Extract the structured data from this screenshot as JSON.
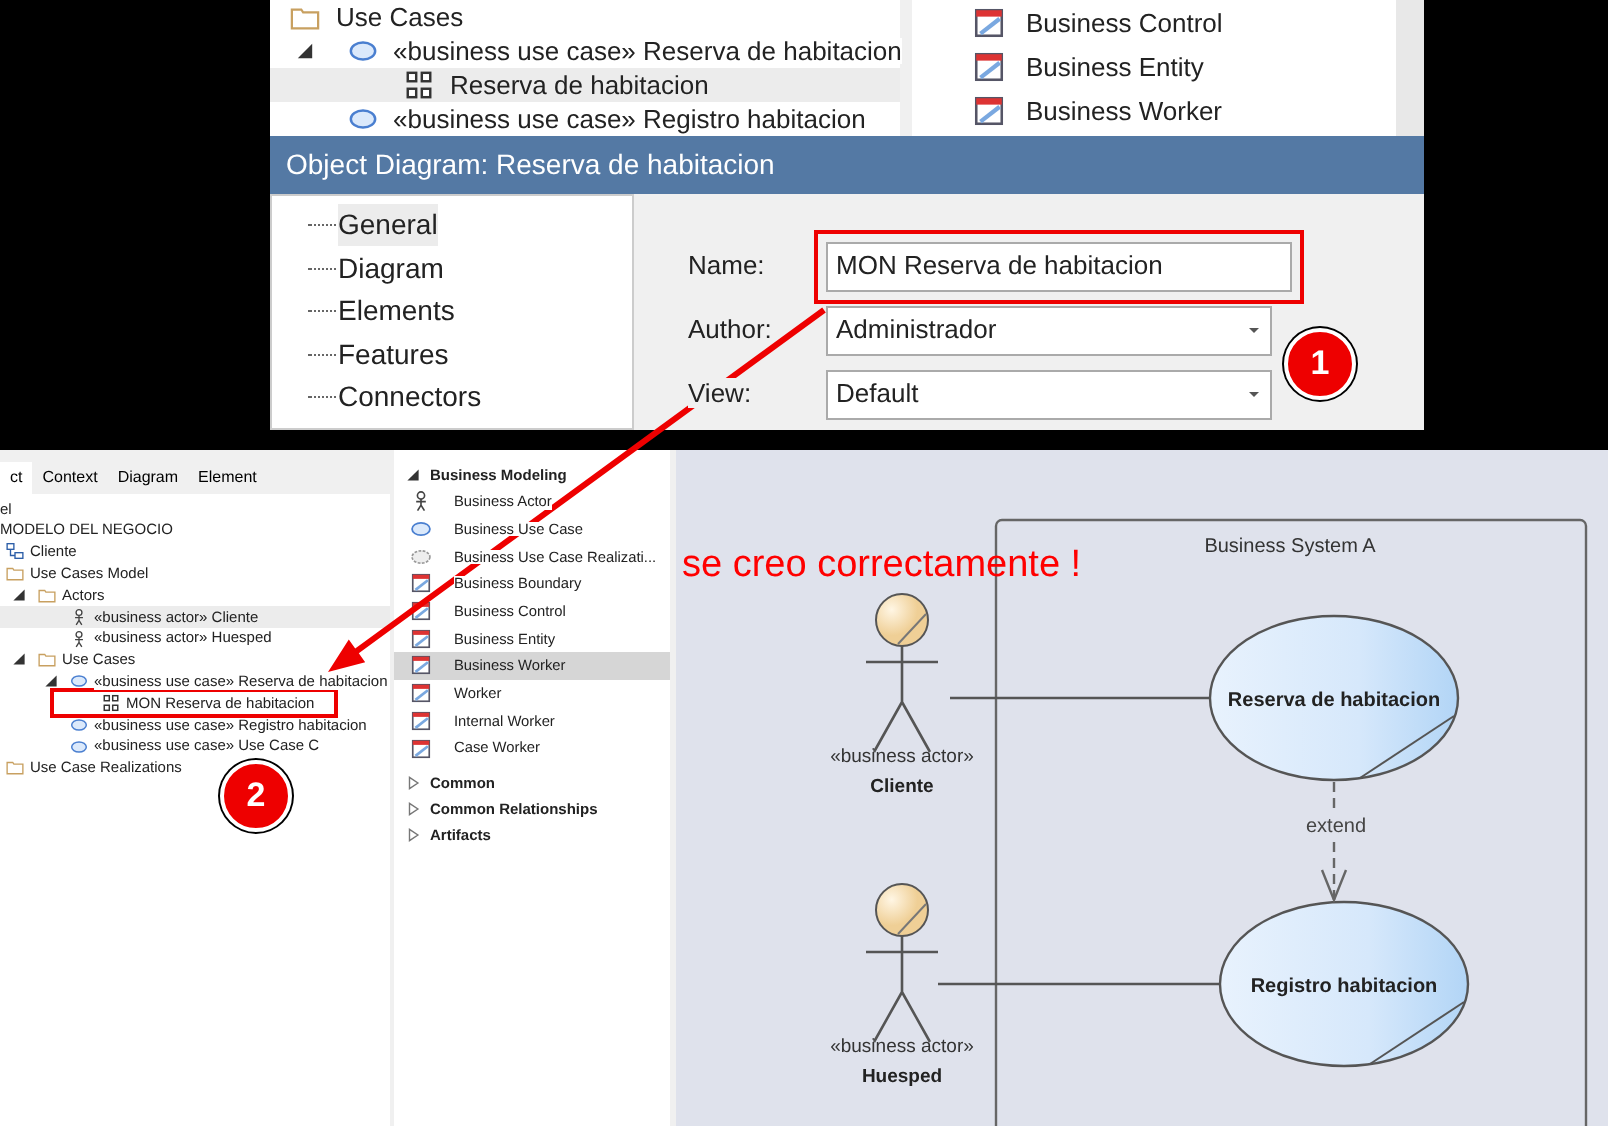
{
  "top_browser": {
    "items": [
      {
        "label": "Use Cases",
        "kind": "folder",
        "selected": false,
        "children": [
          {
            "label": "«business use case» Reserva de habitacion",
            "kind": "usecase",
            "expanded": true,
            "selected": false,
            "children": [
              {
                "label": "Reserva de habitacion",
                "kind": "diagram",
                "selected": true
              }
            ]
          },
          {
            "label": "«business use case» Registro habitacion",
            "kind": "usecase",
            "selected": false
          }
        ]
      }
    ]
  },
  "top_toolbox": {
    "items": [
      {
        "label": "Business Control",
        "kind": "class"
      },
      {
        "label": "Business Entity",
        "kind": "class"
      },
      {
        "label": "Business Worker",
        "kind": "class"
      }
    ]
  },
  "dialog": {
    "title": "Object Diagram: Reserva de habitacion",
    "nav": [
      {
        "label": "General",
        "selected": true
      },
      {
        "label": "Diagram",
        "selected": false
      },
      {
        "label": "Elements",
        "selected": false
      },
      {
        "label": "Features",
        "selected": false
      },
      {
        "label": "Connectors",
        "selected": false
      }
    ],
    "fields": [
      {
        "label": "Name:",
        "kind": "text",
        "value": "MON Reserva de habitacion",
        "highlighted": true
      },
      {
        "label": "Author:",
        "kind": "select",
        "value": "Administrador"
      },
      {
        "label": "View:",
        "kind": "select",
        "value": "Default"
      }
    ]
  },
  "browser": {
    "tabs": [
      {
        "label": "ct",
        "selected": true
      },
      {
        "label": "Context",
        "selected": false
      },
      {
        "label": "Diagram",
        "selected": false
      },
      {
        "label": "Element",
        "selected": false
      }
    ],
    "items": [
      {
        "label": "el",
        "selected": false
      },
      {
        "label": "MODELO DEL NEGOCIO",
        "selected": false,
        "children": [
          {
            "label": "Cliente",
            "kind": "package-diagram",
            "selected": false
          },
          {
            "label": "Use Cases Model",
            "kind": "folder",
            "selected": false,
            "children": [
              {
                "label": "Actors",
                "kind": "folder",
                "expanded": true,
                "selected": false,
                "children": [
                  {
                    "label": "«business actor» Cliente",
                    "kind": "actor",
                    "selected": true
                  },
                  {
                    "label": "«business actor» Huesped",
                    "kind": "actor",
                    "selected": false
                  }
                ]
              },
              {
                "label": "Use Cases",
                "kind": "folder",
                "expanded": true,
                "selected": false,
                "children": [
                  {
                    "label": "«business use case» Reserva de habitacion",
                    "kind": "usecase",
                    "expanded": true,
                    "selected": false,
                    "children": [
                      {
                        "label": "MON Reserva de habitacion",
                        "kind": "diagram",
                        "selected": false,
                        "highlighted": true
                      }
                    ]
                  },
                  {
                    "label": "«business use case» Registro habitacion",
                    "kind": "usecase",
                    "selected": false
                  },
                  {
                    "label": "«business use case» Use Case C",
                    "kind": "usecase",
                    "selected": false
                  }
                ]
              }
            ]
          },
          {
            "label": "Use Case Realizations",
            "kind": "folder",
            "selected": false
          }
        ]
      }
    ]
  },
  "toolbox": {
    "groups": [
      {
        "label": "Business Modeling",
        "expanded": true,
        "items": [
          {
            "label": "Business Actor",
            "kind": "actor",
            "selected": false
          },
          {
            "label": "Business Use Case",
            "kind": "usecase",
            "selected": false
          },
          {
            "label": "Business Use Case Realizati...",
            "kind": "realization",
            "selected": false
          },
          {
            "label": "Business Boundary",
            "kind": "class",
            "selected": false
          },
          {
            "label": "Business Control",
            "kind": "class",
            "selected": false
          },
          {
            "label": "Business Entity",
            "kind": "class",
            "selected": false
          },
          {
            "label": "Business Worker",
            "kind": "class",
            "selected": true
          },
          {
            "label": "Worker",
            "kind": "class",
            "selected": false
          },
          {
            "label": "Internal Worker",
            "kind": "class",
            "selected": false
          },
          {
            "label": "Case Worker",
            "kind": "class",
            "selected": false
          }
        ]
      },
      {
        "label": "Common",
        "expanded": false
      },
      {
        "label": "Common Relationships",
        "expanded": false
      },
      {
        "label": "Artifacts",
        "expanded": false
      }
    ]
  },
  "diagram": {
    "message": "se creo correctamente !",
    "boundary": "Business System A",
    "actors": [
      {
        "stereotype": "«business actor»",
        "name": "Cliente"
      },
      {
        "stereotype": "«business actor»",
        "name": "Huesped"
      }
    ],
    "use_cases": [
      {
        "name": "Reserva de habitacion"
      },
      {
        "name": "Registro habitacion"
      }
    ],
    "relation": "extend"
  },
  "callouts": [
    "1",
    "2"
  ]
}
